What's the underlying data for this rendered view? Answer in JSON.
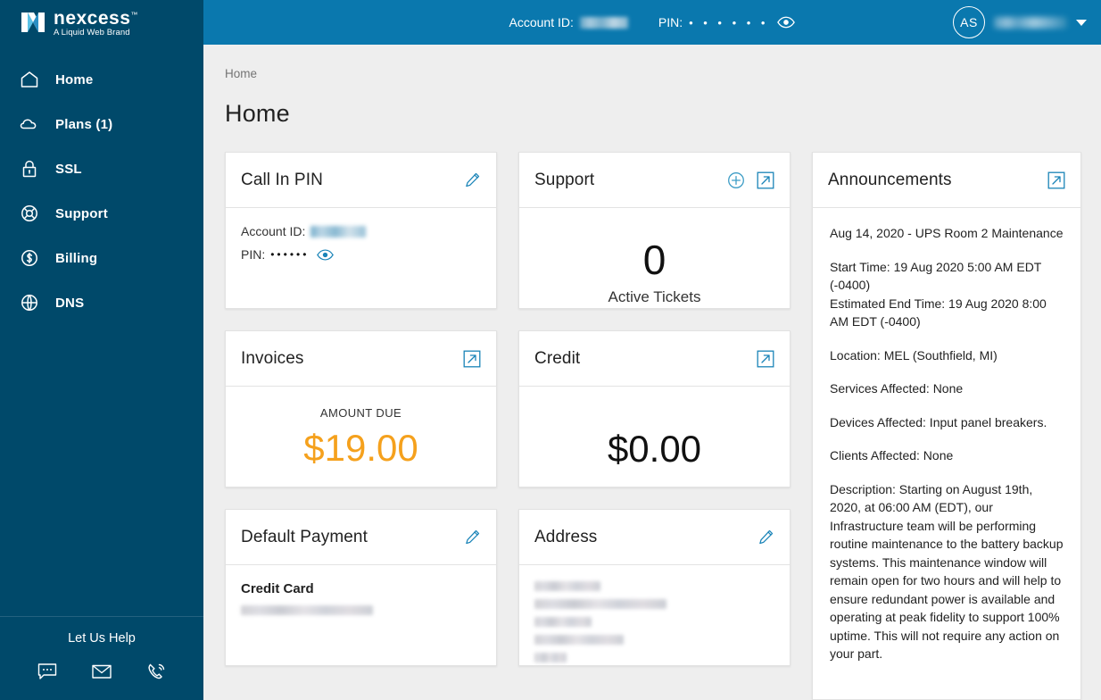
{
  "brand": {
    "name": "nexcess",
    "tm": "™",
    "tagline": "A Liquid Web Brand",
    "logo_icon": "nexcess-n-logo"
  },
  "colors": {
    "sidebar_bg": "#00496a",
    "topbar_bg": "#0a78ae",
    "accent_link": "#0a78ae",
    "amount_due": "#f5a11d",
    "page_bg": "#eeeeee",
    "card_bg": "#ffffff"
  },
  "sidebar": {
    "items": [
      {
        "label": "Home",
        "icon": "home-icon"
      },
      {
        "label": "Plans (1)",
        "icon": "cloud-icon"
      },
      {
        "label": "SSL",
        "icon": "lock-icon"
      },
      {
        "label": "Support",
        "icon": "lifebuoy-icon"
      },
      {
        "label": "Billing",
        "icon": "dollar-circle-icon"
      },
      {
        "label": "DNS",
        "icon": "globe-icon"
      }
    ],
    "help": {
      "title": "Let Us Help",
      "icons": [
        "chat-bubble-icon",
        "envelope-icon",
        "phone-ring-icon"
      ]
    }
  },
  "topbar": {
    "account_id_label": "Account ID:",
    "account_id_value": "",
    "pin_label": "PIN:",
    "pin_masked": "• • • • • •",
    "eye_icon": "eye-icon",
    "avatar_initials": "AS",
    "user_name": "",
    "caret_icon": "chevron-down-icon"
  },
  "breadcrumb": "Home",
  "page_title": "Home",
  "cards": {
    "call_in_pin": {
      "title": "Call In PIN",
      "edit_icon": "pencil-icon",
      "account_id_label": "Account ID:",
      "account_id_value": "",
      "pin_label": "PIN:",
      "pin_masked": "••••••",
      "eye_icon": "eye-icon"
    },
    "support": {
      "title": "Support",
      "add_icon": "plus-circle-icon",
      "open_icon": "external-link-icon",
      "count": "0",
      "count_label": "Active Tickets"
    },
    "invoices": {
      "title": "Invoices",
      "open_icon": "external-link-icon",
      "amount_label": "AMOUNT DUE",
      "amount": "$19.00"
    },
    "credit": {
      "title": "Credit",
      "open_icon": "external-link-icon",
      "amount": "$0.00"
    },
    "default_payment": {
      "title": "Default Payment",
      "edit_icon": "pencil-icon",
      "method": "Credit Card",
      "detail_value": ""
    },
    "address": {
      "title": "Address",
      "edit_icon": "pencil-icon",
      "lines": [
        "",
        "",
        "",
        "",
        ""
      ]
    },
    "announcements": {
      "title": "Announcements",
      "open_icon": "external-link-icon",
      "heading": "Aug 14, 2020 - UPS Room 2 Maintenance",
      "start_time": "Start Time: 19 Aug 2020 5:00 AM EDT (-0400)",
      "end_time": "Estimated End Time: 19 Aug 2020 8:00 AM EDT (-0400)",
      "location": "Location: MEL (Southfield, MI)",
      "services_affected": "Services Affected: None",
      "devices_affected": "Devices Affected: Input panel breakers.",
      "clients_affected": "Clients Affected: None",
      "description": "Description: Starting on August 19th, 2020, at 06:00 AM (EDT), our Infrastructure team will be performing routine maintenance to the battery backup systems. This maintenance window will remain open for two hours and will help to ensure redundant power is available and operating at peak fidelity to support 100% uptime. This will not require any action on your part."
    }
  }
}
